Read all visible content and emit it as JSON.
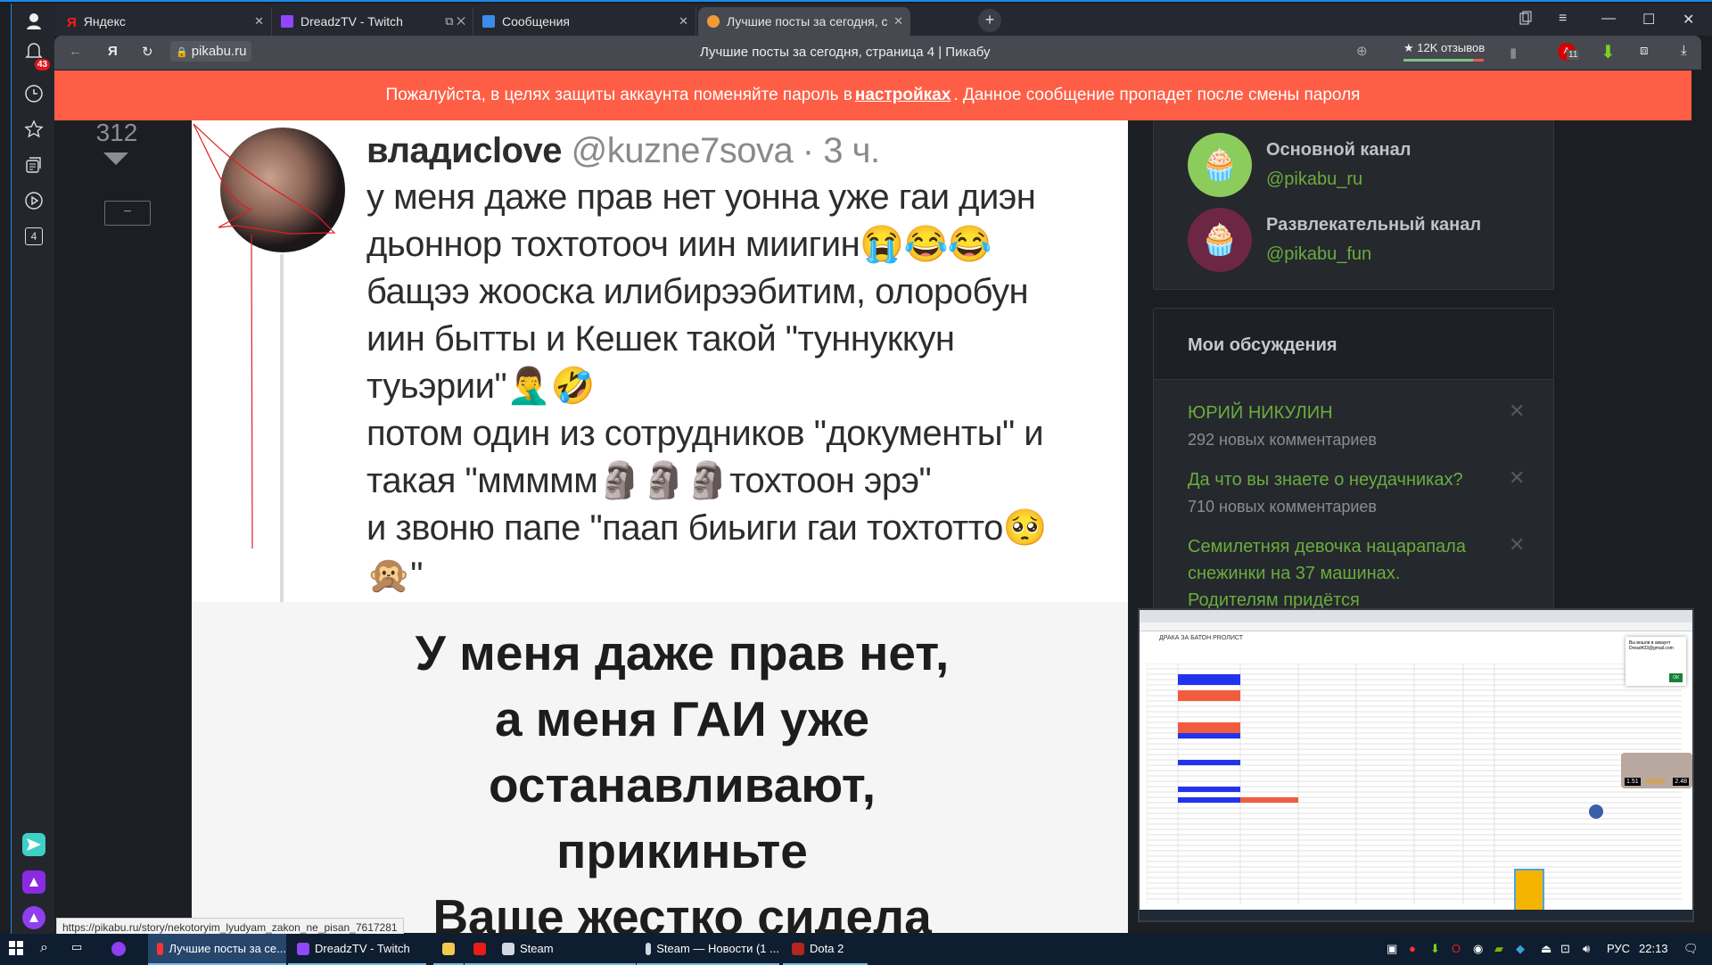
{
  "browser": {
    "tabs": [
      {
        "label": "Яндекс",
        "icon": "yandex-icon",
        "color": "#ff0000"
      },
      {
        "label": "DreadzTV - Twitch",
        "icon": "twitch-icon",
        "color": "#9146ff"
      },
      {
        "label": "Сообщения",
        "icon": "messages-icon",
        "color": "#3d8bea"
      },
      {
        "label": "Лучшие посты за сегодня, с",
        "icon": "pikabu-icon",
        "color": "#f29a35",
        "active": true
      }
    ],
    "new_tab": "+",
    "window_controls": {
      "bookmarks": "▯",
      "menu": "≡",
      "minimize": "—",
      "maximize": "☐",
      "close": "✕"
    },
    "address": {
      "back": "←",
      "yandex_logo": "Я",
      "reload": "↻",
      "url": "pikabu.ru",
      "page_title": "Лучшие посты за сегодня, страница 4 | Пикабу",
      "reviews": "★ 12K отзывов",
      "reviews_positive_fraction": 0.87,
      "adblock_count": "11"
    },
    "sidebar": {
      "notifications_badge": "43",
      "tab_count": "4"
    }
  },
  "notice": {
    "before": "Пожалуйста, в целях защиты аккаунта поменяйте пароль в",
    "link": "настройках",
    "after": ". Данное сообщение пропадет после смены пароля"
  },
  "post": {
    "rating": "312",
    "collapse": "−",
    "tweet": {
      "name": "владиclove",
      "handle": "@kuzne7sova · 3 ч.",
      "lines": [
        "у меня даже прав нет уонна уже гаи диэн",
        "дьоннор тохтотооч иин миигин😭😂😂",
        "бащээ жооска илибирээбитим, олоробун",
        "иин бытты и Кешек такой \"туннуккун",
        "туьэрии\"🤦‍♂️🤣",
        "потом один из сотрудников \"документы\" и",
        "такая \"ммммм🗿🗿🗿тохтоон эрэ\"",
        "и звоню папе \"паап биьиги гаи тохтотто🥺",
        "🙊\""
      ]
    },
    "meme_lines": [
      "У меня даже прав   нет,",
      "а меня ГАИ уже",
      "останавливают,",
      "прикиньте",
      "Ваще жестко сидела"
    ]
  },
  "channels": [
    {
      "name": "Основной канал",
      "handle": "@pikabu_ru",
      "bg": "#8ccc5c"
    },
    {
      "name": "Развлекательный канал",
      "handle": "@pikabu_fun",
      "bg": "#6e2645"
    }
  ],
  "discussions": {
    "title": "Мои обсуждения",
    "items": [
      {
        "title": "ЮРИЙ НИКУЛИН",
        "sub": "292 новых комментариев"
      },
      {
        "title": "Да что вы знаете о неудачниках?",
        "sub": "710 новых комментариев"
      },
      {
        "title": "Семилетняя девочка нацарапала снежинки на 37 машинах. Родителям придётся компенсировать ущерб",
        "sub": ""
      }
    ],
    "close": "✕"
  },
  "pip": {
    "doc_title": "ДРАКА ЗА БАТОН PROЛИСТ",
    "signed_out": "Вы вошли в аккаунт",
    "email": "Dread433@gmail.com",
    "ok": "ОК",
    "odds_left": "1.51",
    "odds_right": "2.48",
    "bookmaker": "GGBET"
  },
  "status_url": "https://pikabu.ru/story/nekotoryim_lyudyam_zakon_ne_pisan_7617281",
  "taskbar": {
    "items": [
      {
        "label": "Лучшие посты за се...",
        "icon": "yandex-browser-icon",
        "active": true
      },
      {
        "label": "DreadzTV - Twitch",
        "icon": "twitch-icon"
      },
      {
        "label": "",
        "icon": "file-explorer-icon"
      },
      {
        "label": "",
        "icon": "opera-icon"
      },
      {
        "label": "Steam",
        "icon": "steam-icon"
      },
      {
        "label": "Steam — Новости (1 ...",
        "icon": "steam-icon"
      },
      {
        "label": "Dota 2",
        "icon": "dota-icon"
      }
    ],
    "lang": "РУС",
    "time": "22:13"
  }
}
